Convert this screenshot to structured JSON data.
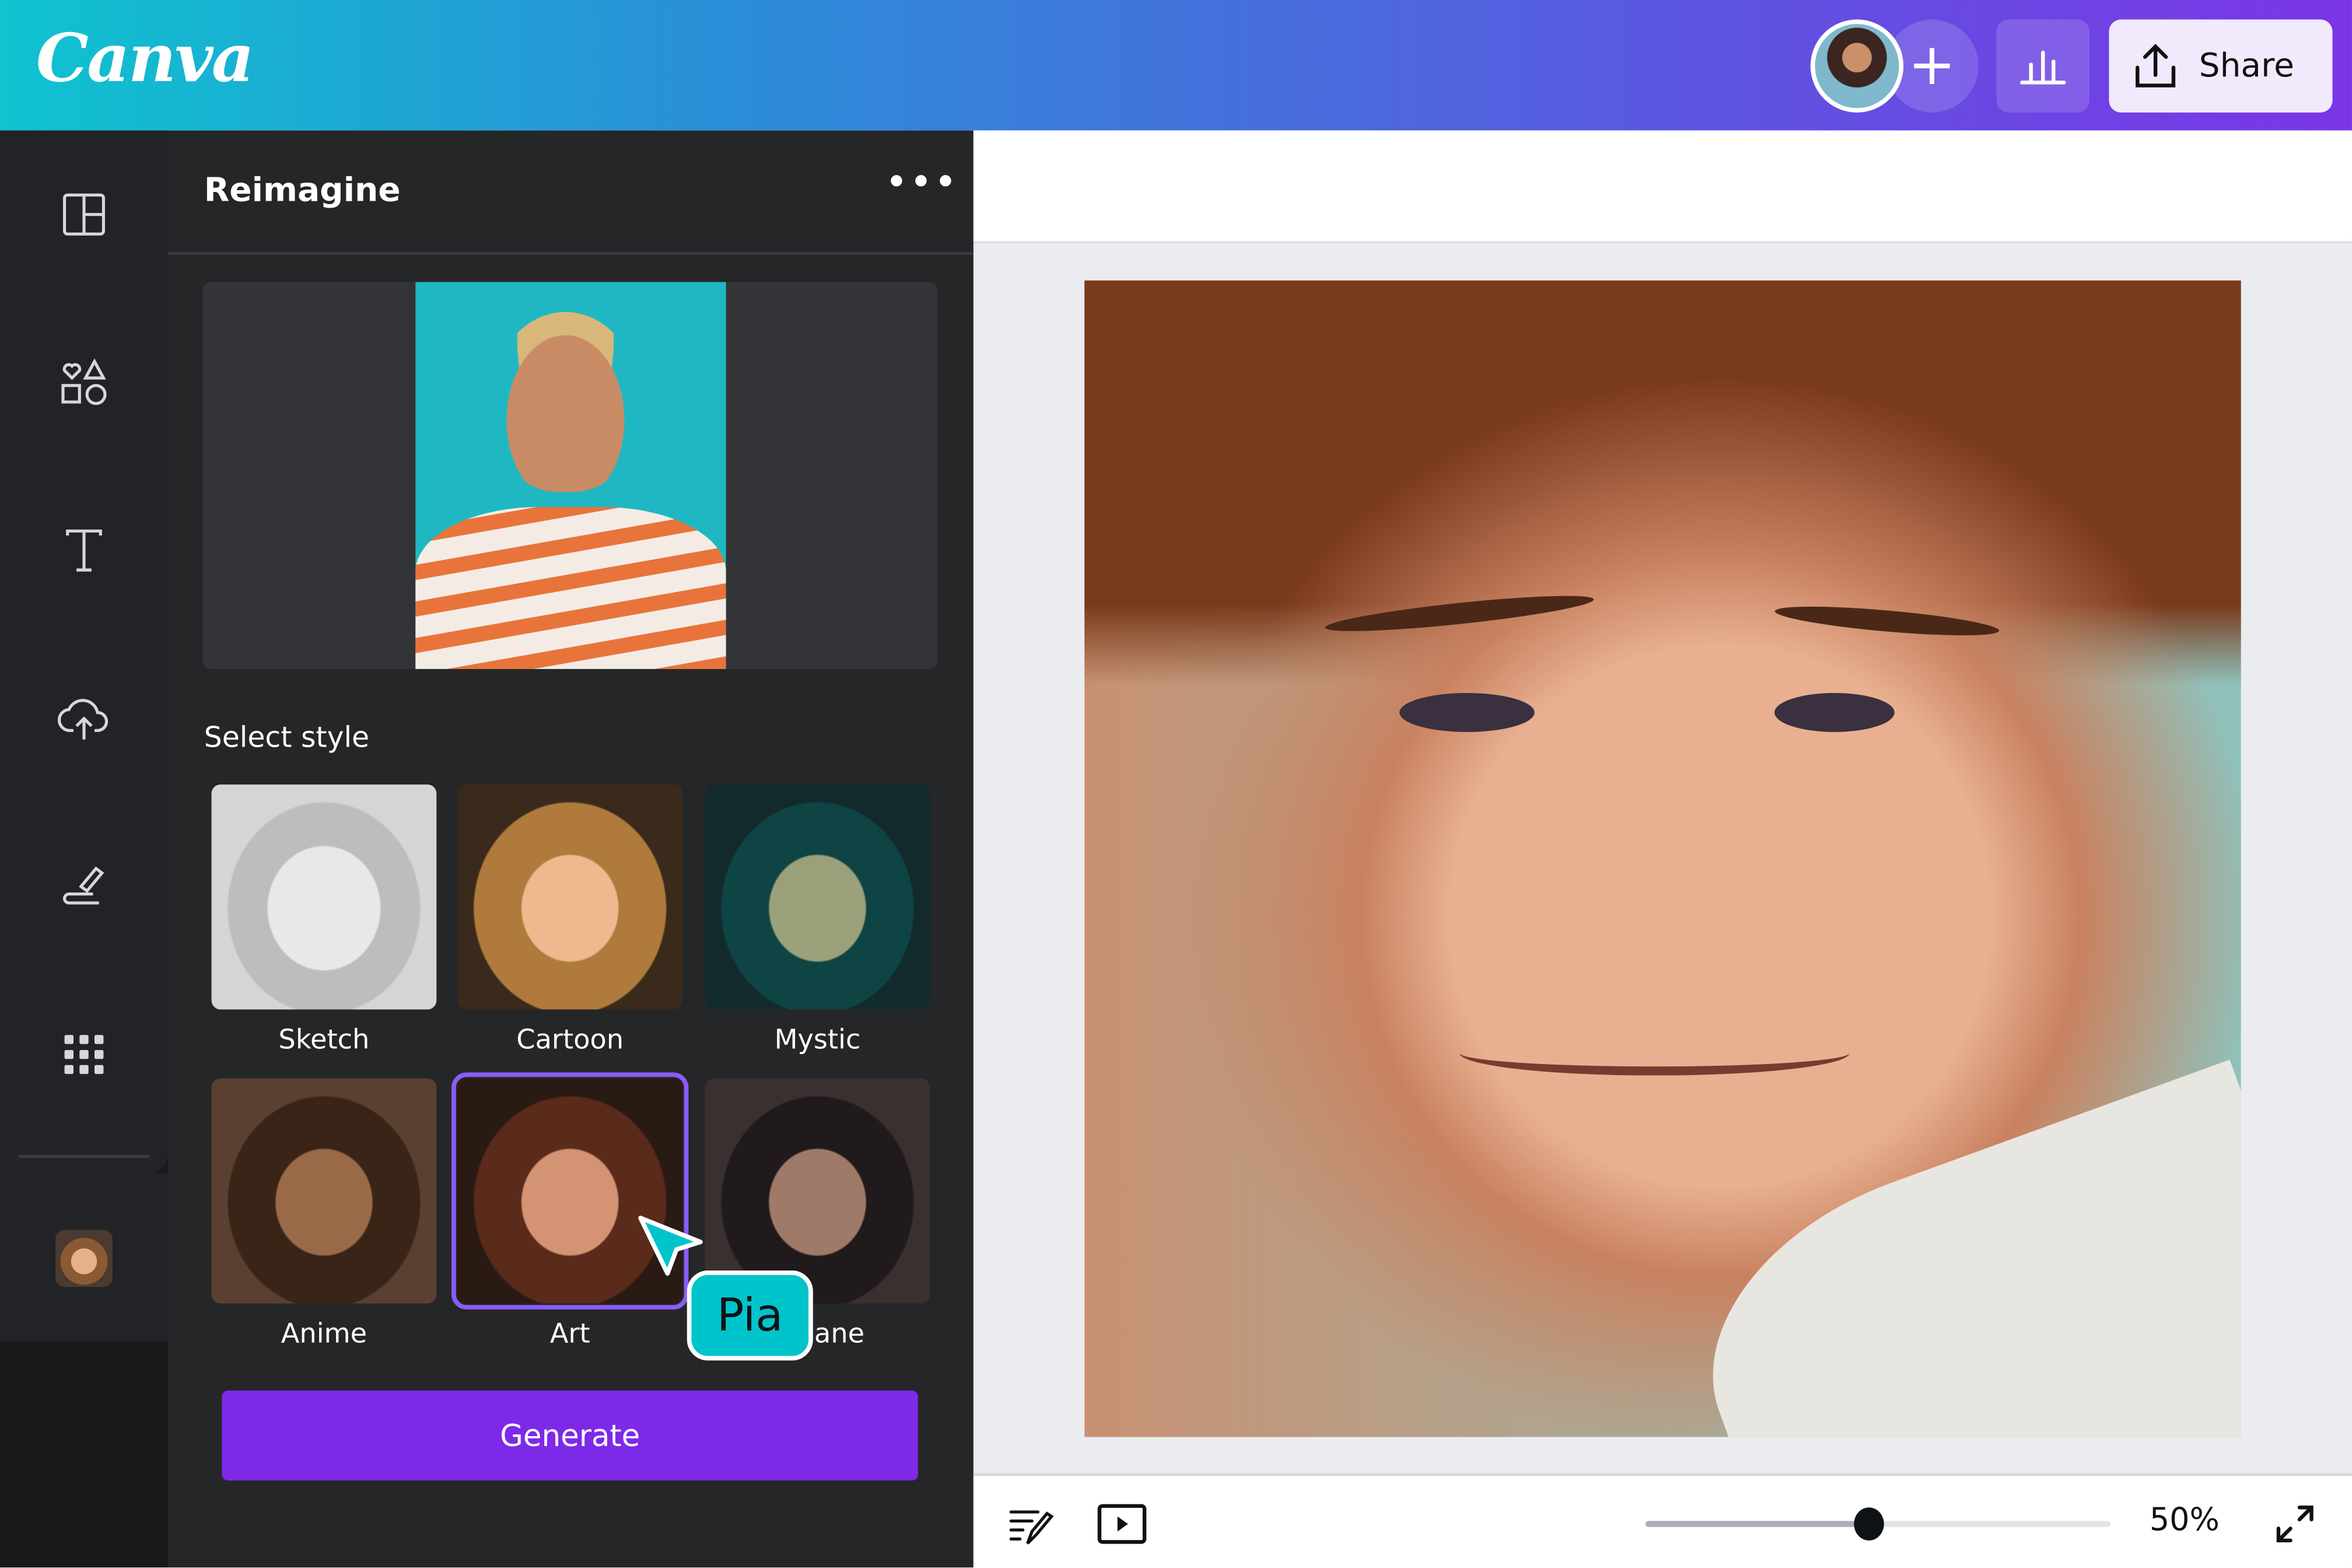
{
  "header": {
    "logo": "Canva",
    "share_label": "Share",
    "add_icon": "plus-icon",
    "stats_icon": "bar-chart-icon",
    "share_icon": "upload-icon"
  },
  "rail": {
    "icons": [
      "layout-icon",
      "elements-icon",
      "text-icon",
      "upload-cloud-icon",
      "draw-icon",
      "apps-icon",
      "app-avatar-icon"
    ]
  },
  "panel": {
    "title": "Reimagine",
    "more_label": "•••",
    "select_style": "Select style",
    "styles": [
      {
        "label": "Sketch"
      },
      {
        "label": "Cartoon"
      },
      {
        "label": "Mystic"
      },
      {
        "label": "Anime"
      },
      {
        "label": "Art",
        "selected": true
      },
      {
        "label": "Arcane"
      }
    ],
    "generate_label": "Generate",
    "collaborator_tag": "Pia"
  },
  "footer": {
    "zoom_label": "50%",
    "zoom_fraction": 0.48
  },
  "colors": {
    "accent": "#7d2ae8",
    "selected_outline": "#8b5cf6",
    "pia_tag": "#00c4cc"
  }
}
